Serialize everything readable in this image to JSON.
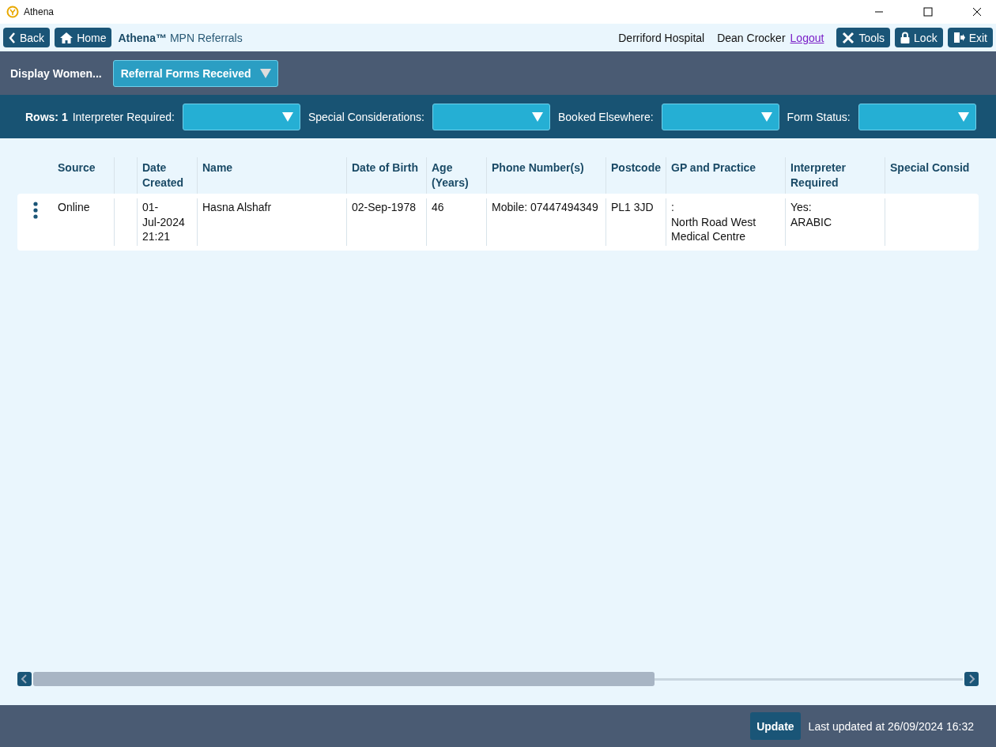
{
  "window": {
    "title": "Athena"
  },
  "toolbar": {
    "back": "Back",
    "home": "Home",
    "app_name": "Athena™",
    "page_title": "MPN Referrals",
    "hospital": "Derriford Hospital",
    "user": "Dean Crocker",
    "logout": "Logout",
    "tools": "Tools",
    "lock": "Lock",
    "exit": "Exit"
  },
  "display_bar": {
    "label": "Display Women...",
    "dropdown": "Referral Forms Received"
  },
  "filters": {
    "rows_label": "Rows: 1",
    "items": [
      {
        "label": "Interpreter Required:"
      },
      {
        "label": "Special Considerations:"
      },
      {
        "label": "Booked Elsewhere:"
      },
      {
        "label": "Form Status:"
      }
    ]
  },
  "table": {
    "columns": [
      "",
      "Source",
      "",
      "Date Created",
      "Name",
      "Date of Birth",
      "Age (Years)",
      "Phone Number(s)",
      "Postcode",
      "GP and Practice",
      "Interpreter Required",
      "Special Consid"
    ],
    "rows": [
      {
        "cells": [
          "",
          "Online",
          "",
          "01-\nJul-2024\n21:21",
          "Hasna Alshafr",
          "02-Sep-1978",
          "46",
          "Mobile: 07447494349",
          "PL1 3JD",
          ":\nNorth Road West\nMedical Centre",
          "Yes:\nARABIC",
          ""
        ]
      }
    ]
  },
  "footer": {
    "update": "Update",
    "last_updated": "Last updated at 26/09/2024 16:32"
  }
}
